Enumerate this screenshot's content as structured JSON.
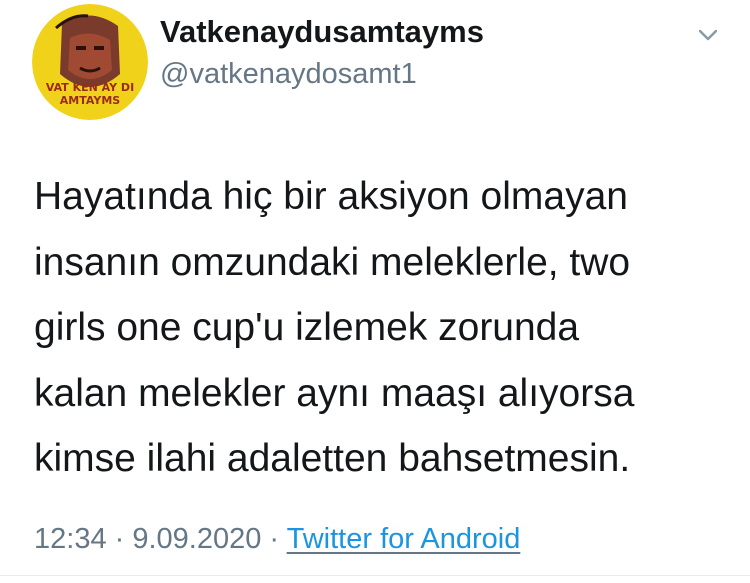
{
  "colors": {
    "text_primary": "#14171a",
    "text_secondary": "#657786",
    "link": "#1b95e0",
    "avatar_background": "#f0d21a"
  },
  "user": {
    "display_name": "Vatkenaydusamtayms",
    "handle": "@vatkenaydosamt1",
    "avatar_icon": "profile-portrait-icon",
    "avatar_text_line1": "VAT KEN AY DI",
    "avatar_text_line2": "AMTAYMS"
  },
  "menu": {
    "icon": "chevron-down-icon"
  },
  "tweet": {
    "lines": [
      "Hayatında hiç bir aksiyon olmayan",
      "insanın omzundaki meleklerle, two",
      "girls one cup'u izlemek zorunda",
      "kalan melekler aynı maaşı alıyorsa",
      "kimse ilahi adaletten bahsetmesin."
    ]
  },
  "meta": {
    "time": "12:34",
    "separator": " · ",
    "date": "9.09.2020",
    "source": "Twitter for Android"
  }
}
